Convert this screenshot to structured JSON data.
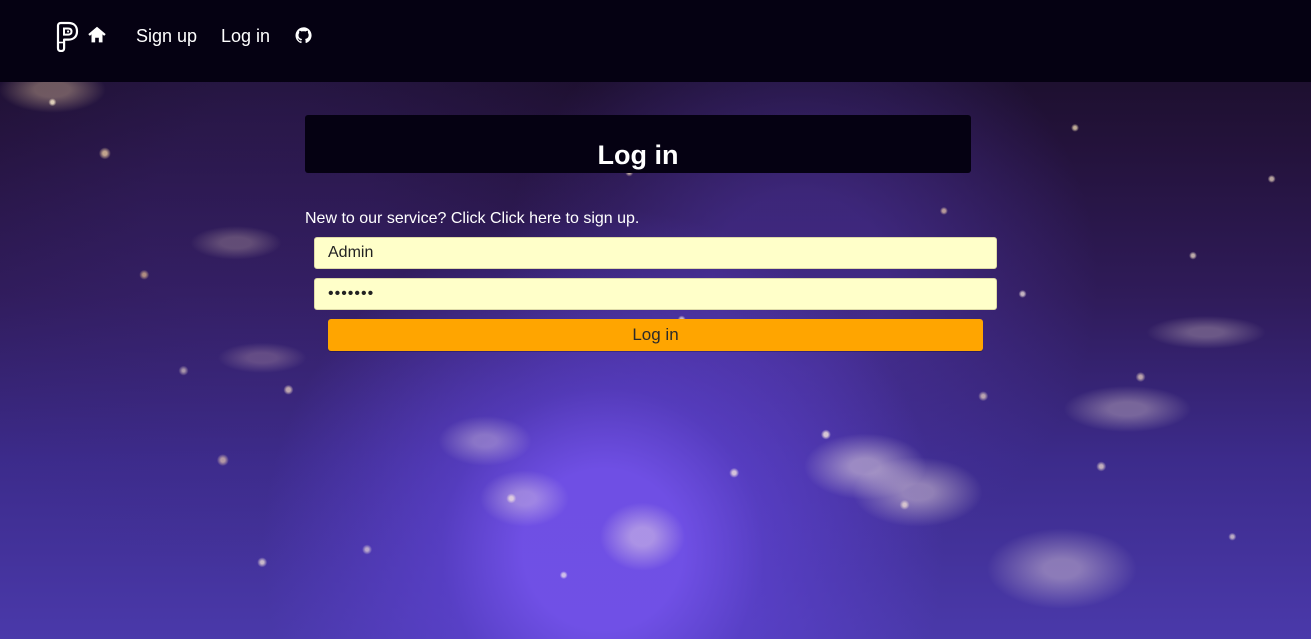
{
  "nav": {
    "brand_icon": "brand-logo-icon",
    "home_icon": "home-icon",
    "signup_label": "Sign up",
    "login_label": "Log in",
    "github_icon": "github-icon"
  },
  "login": {
    "title": "Log in",
    "prompt_prefix": "New to our service? Click ",
    "signup_link_label": "Click here",
    "prompt_suffix": " to sign up.",
    "username_value": "Admin",
    "password_value": "•••••••",
    "submit_label": "Log in"
  },
  "colors": {
    "navbar_background": "#050112",
    "input_background": "#ffffc9",
    "submit_background": "#ffa500",
    "text_white": "#ffffff"
  }
}
